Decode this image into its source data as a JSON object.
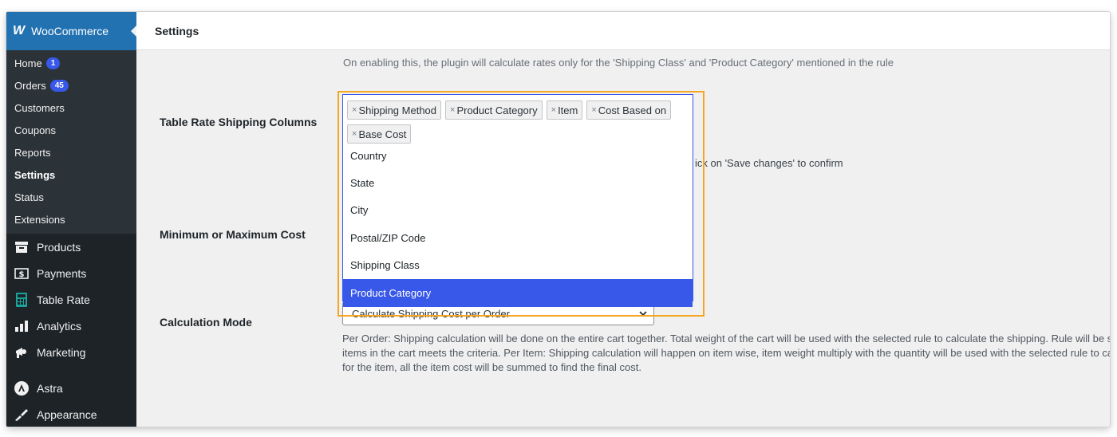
{
  "app": {
    "title": "WooCommerce",
    "logo": "W"
  },
  "header": {
    "page_title": "Settings"
  },
  "sidebar": {
    "submenu": [
      {
        "label": "Home",
        "badge": "1"
      },
      {
        "label": "Orders",
        "badge": "45"
      },
      {
        "label": "Customers"
      },
      {
        "label": "Coupons"
      },
      {
        "label": "Reports"
      },
      {
        "label": "Settings"
      },
      {
        "label": "Status"
      },
      {
        "label": "Extensions"
      }
    ],
    "menu": [
      {
        "label": "Products",
        "icon": "archive-icon"
      },
      {
        "label": "Payments",
        "icon": "dollar-card-icon"
      },
      {
        "label": "Table Rate",
        "icon": "calculator-icon"
      },
      {
        "label": "Analytics",
        "icon": "bar-chart-icon"
      },
      {
        "label": "Marketing",
        "icon": "megaphone-icon"
      },
      {
        "label": "Astra",
        "icon": "astra-icon"
      },
      {
        "label": "Appearance",
        "icon": "brush-icon"
      }
    ]
  },
  "content": {
    "cut_text": "On enabling this, the plugin will calculate rates only for the 'Shipping Class' and 'Product Category' mentioned in the rule",
    "table_rate_label": "Table Rate Shipping Columns",
    "selected_tags": [
      "Shipping Method",
      "Product Category",
      "Item",
      "Cost Based on",
      "Base Cost"
    ],
    "dropdown_options": [
      "Country",
      "State",
      "City",
      "Postal/ZIP Code",
      "Shipping Class",
      "Product Category"
    ],
    "highlighted_option": "Product Category",
    "behind_text": "ick on 'Save changes' to confirm",
    "min_max_label": "Minimum or Maximum Cost",
    "calc_mode_label": "Calculation Mode",
    "calc_mode_value": "Calculate Shipping Cost per Order",
    "calc_mode_desc": "Per Order: Shipping calculation will be done on the entire cart together. Total weight of the cart will be used with the selected rule to calculate the shipping. Rule will be satisfied if one of the items in the cart meets the criteria. Per Item: Shipping calculation will happen on item wise, item weight multiply with the quantity will be used with the selected rule to calculate the shipping cost for the item, all the item cost will be summed to find the final cost."
  },
  "colors": {
    "sidebar": "#1d2327",
    "accent": "#2271b1",
    "highlight": "#3858e9",
    "callout": "#f5a623"
  }
}
